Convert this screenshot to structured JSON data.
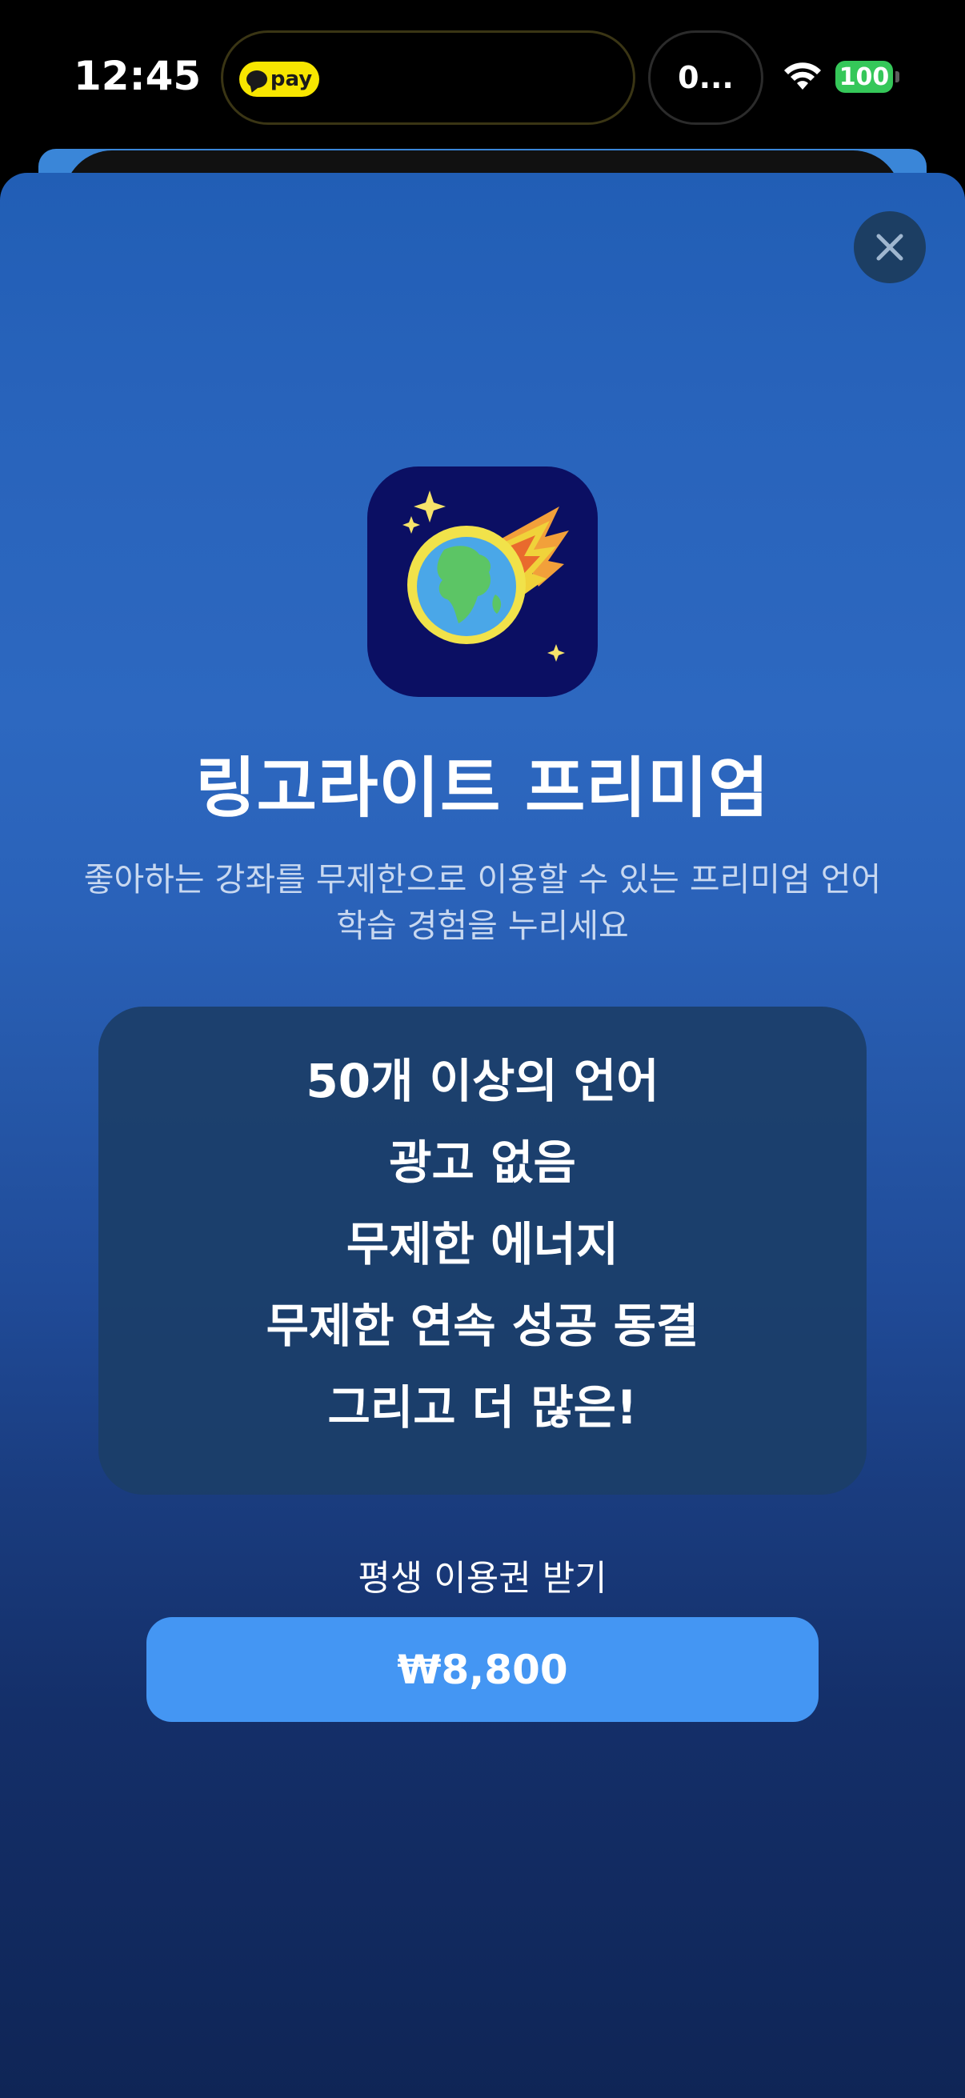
{
  "status_bar": {
    "time": "12:45",
    "pay_badge": "pay",
    "island_text": "0...",
    "battery": "100"
  },
  "paywall": {
    "title": "링고라이트 프리미엄",
    "subtitle_line1": "좋아하는 강좌를 무제한으로 이용할 수 있는 프리미엄 언어",
    "subtitle_line2": "학습 경험을 누리세요",
    "features": [
      "50개 이상의 언어",
      "광고 없음",
      "무제한 에너지",
      "무제한 연속 성공 동결",
      "그리고 더 많은!"
    ],
    "lifetime_label": "평생 이용권 받기",
    "price": "₩8,800"
  },
  "icons": {
    "close": "close-icon",
    "app": "comet-earth-icon",
    "wifi": "wifi-icon"
  },
  "colors": {
    "sheet_top": "#215eb5",
    "sheet_bottom": "#0f2556",
    "button": "#4496f3",
    "app_icon_bg": "#0b0f63"
  }
}
